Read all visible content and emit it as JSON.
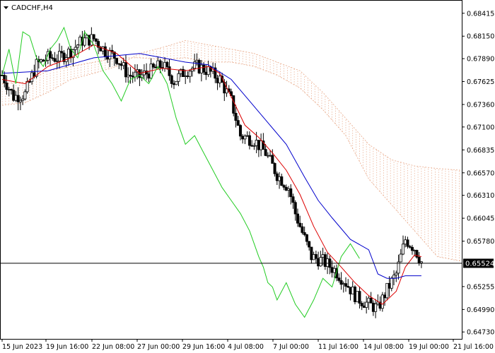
{
  "chart_data": {
    "type": "candlestick",
    "symbol_title": "CADCHF,H4",
    "y_ticks": [
      0.68415,
      0.6815,
      0.6789,
      0.67625,
      0.6736,
      0.671,
      0.66835,
      0.6657,
      0.6631,
      0.66045,
      0.6578,
      0.65255,
      0.6499,
      0.6473
    ],
    "y_tick_labels": [
      "0.68415",
      "0.68150",
      "0.67890",
      "0.67625",
      "0.67360",
      "0.67100",
      "0.66835",
      "0.66570",
      "0.66310",
      "0.66045",
      "0.65780",
      "0.65255",
      "0.64990",
      "0.64730"
    ],
    "ylim": [
      0.6465,
      0.6856
    ],
    "x_tick_labels": [
      "15 Jun 2023",
      "19 Jun 16:00",
      "22 Jun 08:00",
      "27 Jun 00:00",
      "29 Jun 16:00",
      "4 Jul 08:00",
      "7 Jul 00:00",
      "11 Jul 16:00",
      "14 Jul 08:00",
      "19 Jul 00:00",
      "21 Jul 16:00"
    ],
    "current_price": 0.65524,
    "current_price_label": "0.65524",
    "ohlc_anchor_closes": [
      [
        0,
        0.677
      ],
      [
        5,
        0.6745
      ],
      [
        10,
        0.6748
      ],
      [
        15,
        0.6782
      ],
      [
        20,
        0.679
      ],
      [
        25,
        0.679
      ],
      [
        30,
        0.6798
      ],
      [
        35,
        0.681
      ],
      [
        40,
        0.6812
      ],
      [
        45,
        0.6798
      ],
      [
        50,
        0.679
      ],
      [
        55,
        0.677
      ],
      [
        60,
        0.6768
      ],
      [
        65,
        0.6775
      ],
      [
        70,
        0.6782
      ],
      [
        75,
        0.6763
      ],
      [
        80,
        0.6775
      ],
      [
        85,
        0.678
      ],
      [
        90,
        0.6775
      ],
      [
        95,
        0.6765
      ],
      [
        100,
        0.674
      ],
      [
        104,
        0.67
      ],
      [
        110,
        0.6695
      ],
      [
        115,
        0.668
      ],
      [
        120,
        0.6655
      ],
      [
        125,
        0.664
      ],
      [
        128,
        0.661
      ],
      [
        131,
        0.6588
      ],
      [
        135,
        0.656
      ],
      [
        140,
        0.6555
      ],
      [
        145,
        0.6545
      ],
      [
        150,
        0.653
      ],
      [
        155,
        0.6512
      ],
      [
        160,
        0.6505
      ],
      [
        164,
        0.65
      ],
      [
        168,
        0.6522
      ],
      [
        172,
        0.654
      ],
      [
        176,
        0.658
      ],
      [
        180,
        0.657
      ],
      [
        183,
        0.6554
      ]
    ],
    "series": [
      {
        "name": "",
        "role": "tenkan",
        "color": "#dd0000",
        "points": [
          [
            0,
            0.6765
          ],
          [
            10,
            0.676
          ],
          [
            20,
            0.678
          ],
          [
            30,
            0.679
          ],
          [
            40,
            0.6805
          ],
          [
            50,
            0.6795
          ],
          [
            60,
            0.6772
          ],
          [
            70,
            0.6778
          ],
          [
            80,
            0.6775
          ],
          [
            90,
            0.678
          ],
          [
            95,
            0.6772
          ],
          [
            100,
            0.6745
          ],
          [
            106,
            0.6712
          ],
          [
            112,
            0.6698
          ],
          [
            118,
            0.668
          ],
          [
            124,
            0.666
          ],
          [
            130,
            0.6632
          ],
          [
            136,
            0.6595
          ],
          [
            142,
            0.6565
          ],
          [
            148,
            0.6548
          ],
          [
            154,
            0.653
          ],
          [
            160,
            0.6515
          ],
          [
            166,
            0.6505
          ],
          [
            172,
            0.652
          ],
          [
            176,
            0.6548
          ],
          [
            180,
            0.6562
          ],
          [
            183,
            0.656
          ]
        ]
      },
      {
        "name": "",
        "role": "kijun",
        "color": "#0000cc",
        "points": [
          [
            0,
            0.6772
          ],
          [
            20,
            0.6775
          ],
          [
            40,
            0.679
          ],
          [
            60,
            0.6795
          ],
          [
            70,
            0.679
          ],
          [
            80,
            0.6785
          ],
          [
            90,
            0.6782
          ],
          [
            100,
            0.6765
          ],
          [
            108,
            0.674
          ],
          [
            116,
            0.6715
          ],
          [
            124,
            0.669
          ],
          [
            132,
            0.6652
          ],
          [
            138,
            0.6625
          ],
          [
            144,
            0.6605
          ],
          [
            152,
            0.658
          ],
          [
            160,
            0.6568
          ],
          [
            164,
            0.654
          ],
          [
            168,
            0.6535
          ],
          [
            172,
            0.6535
          ],
          [
            176,
            0.6538
          ],
          [
            183,
            0.6538
          ]
        ]
      },
      {
        "name": "",
        "role": "chikou",
        "color": "#22cc22",
        "points": [
          [
            0,
            0.677
          ],
          [
            3,
            0.68
          ],
          [
            6,
            0.676
          ],
          [
            9,
            0.682
          ],
          [
            12,
            0.6815
          ],
          [
            15,
            0.679
          ],
          [
            18,
            0.678
          ],
          [
            21,
            0.68
          ],
          [
            24,
            0.681
          ],
          [
            27,
            0.6825
          ],
          [
            30,
            0.68
          ],
          [
            33,
            0.679
          ],
          [
            36,
            0.682
          ],
          [
            40,
            0.6805
          ],
          [
            44,
            0.6775
          ],
          [
            48,
            0.676
          ],
          [
            52,
            0.674
          ],
          [
            56,
            0.6765
          ],
          [
            60,
            0.677
          ],
          [
            64,
            0.676
          ],
          [
            68,
            0.678
          ],
          [
            72,
            0.676
          ],
          [
            76,
            0.672
          ],
          [
            80,
            0.669
          ],
          [
            84,
            0.67
          ],
          [
            88,
            0.668
          ],
          [
            92,
            0.666
          ],
          [
            96,
            0.664
          ],
          [
            100,
            0.6625
          ],
          [
            104,
            0.661
          ],
          [
            108,
            0.659
          ],
          [
            110,
            0.6575
          ],
          [
            112,
            0.656
          ],
          [
            114,
            0.6548
          ],
          [
            116,
            0.653
          ],
          [
            118,
            0.6525
          ],
          [
            120,
            0.651
          ],
          [
            124,
            0.653
          ],
          [
            128,
            0.6505
          ],
          [
            132,
            0.649
          ],
          [
            136,
            0.651
          ],
          [
            140,
            0.6535
          ],
          [
            144,
            0.6525
          ],
          [
            148,
            0.656
          ],
          [
            152,
            0.6575
          ],
          [
            156,
            0.6558
          ]
        ]
      }
    ],
    "cloud": {
      "color": "#e8a888",
      "span_a": [
        [
          0,
          0.676
        ],
        [
          10,
          0.6762
        ],
        [
          20,
          0.6775
        ],
        [
          30,
          0.678
        ],
        [
          40,
          0.6785
        ],
        [
          50,
          0.679
        ],
        [
          60,
          0.679
        ],
        [
          70,
          0.6788
        ],
        [
          80,
          0.679
        ],
        [
          90,
          0.6785
        ],
        [
          100,
          0.6785
        ],
        [
          110,
          0.678
        ],
        [
          120,
          0.677
        ],
        [
          130,
          0.6755
        ],
        [
          140,
          0.673
        ],
        [
          150,
          0.67
        ],
        [
          160,
          0.665
        ],
        [
          170,
          0.662
        ],
        [
          180,
          0.659
        ],
        [
          190,
          0.656
        ],
        [
          200,
          0.6555
        ]
      ],
      "span_b": [
        [
          0,
          0.6735
        ],
        [
          10,
          0.6738
        ],
        [
          20,
          0.675
        ],
        [
          30,
          0.6765
        ],
        [
          40,
          0.6772
        ],
        [
          50,
          0.678
        ],
        [
          60,
          0.6795
        ],
        [
          70,
          0.6802
        ],
        [
          80,
          0.681
        ],
        [
          90,
          0.6805
        ],
        [
          100,
          0.68
        ],
        [
          110,
          0.6795
        ],
        [
          120,
          0.6785
        ],
        [
          130,
          0.6775
        ],
        [
          140,
          0.675
        ],
        [
          150,
          0.672
        ],
        [
          160,
          0.669
        ],
        [
          170,
          0.6672
        ],
        [
          180,
          0.6665
        ],
        [
          190,
          0.6662
        ],
        [
          200,
          0.666
        ]
      ]
    }
  }
}
